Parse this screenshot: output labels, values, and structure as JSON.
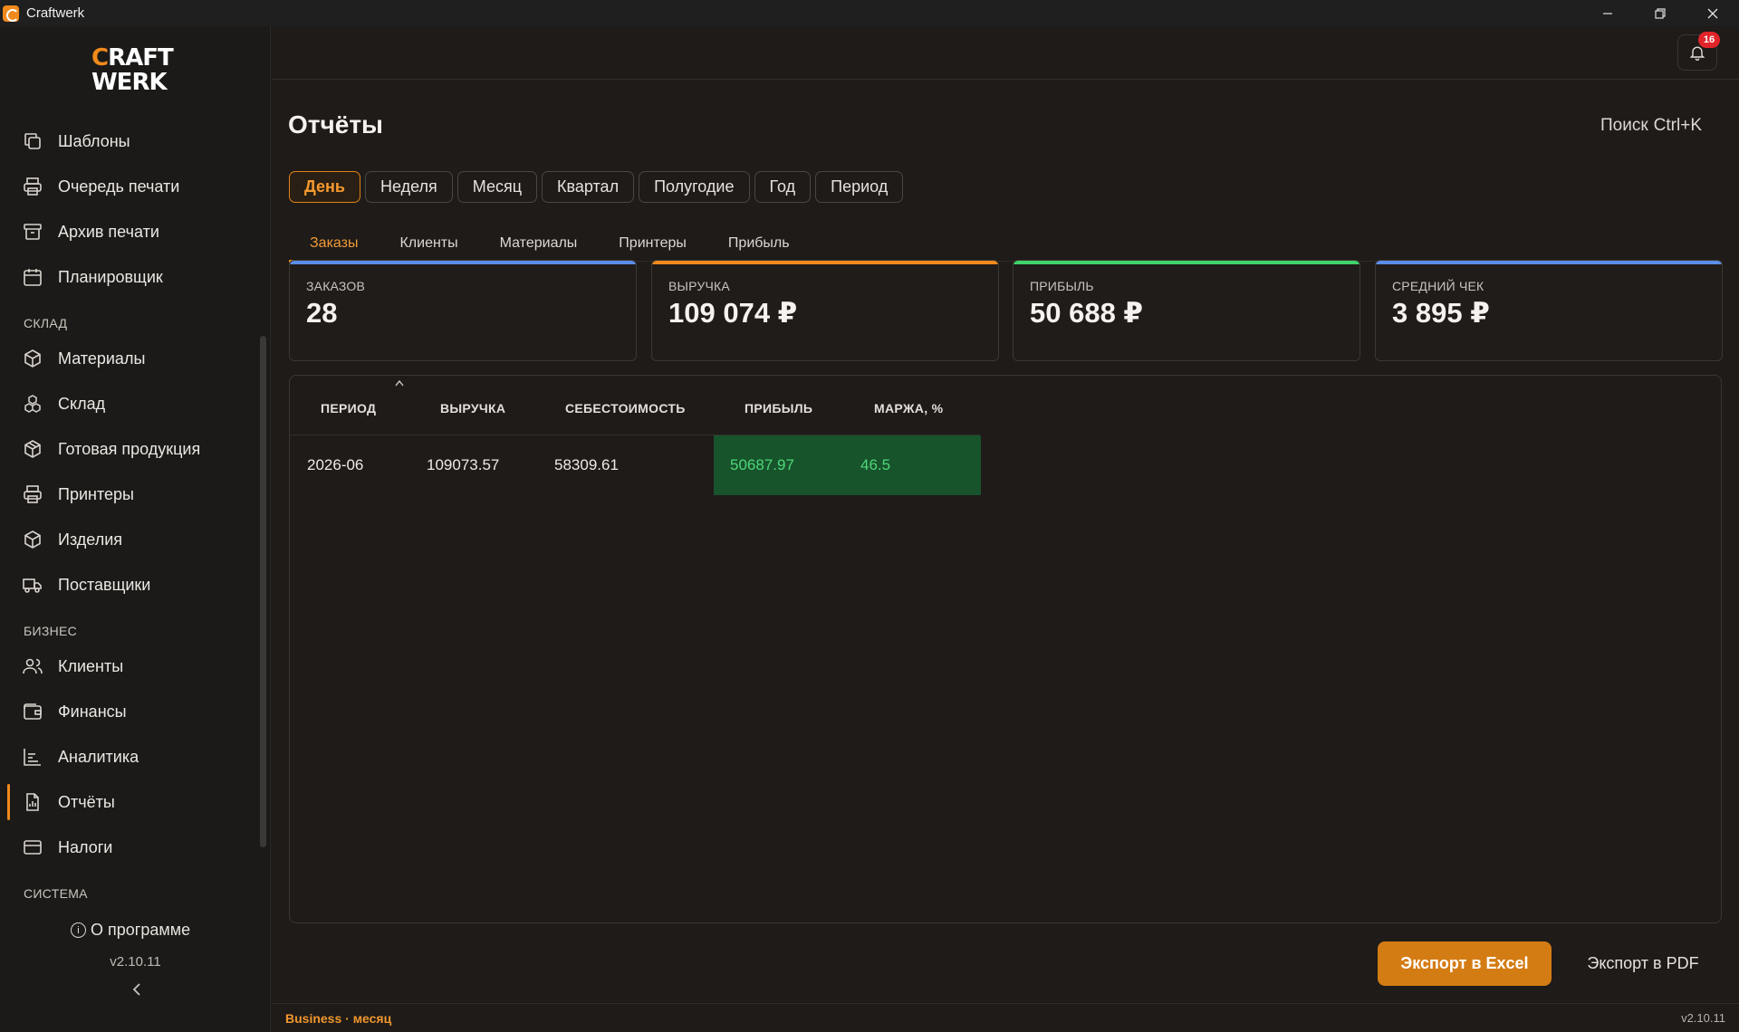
{
  "window": {
    "title": "Craftwerk"
  },
  "logo": {
    "line1": "RAFT",
    "line1_initial": "C",
    "line2": "WERK"
  },
  "sidebar": {
    "items": [
      {
        "label": "Шаблоны",
        "icon": "copy-icon"
      },
      {
        "label": "Очередь печати",
        "icon": "printer-icon"
      },
      {
        "label": "Архив печати",
        "icon": "archive-icon"
      },
      {
        "label": "Планировщик",
        "icon": "calendar-icon"
      }
    ],
    "sections": {
      "warehouse": "СКЛАД",
      "business": "БИЗНЕС",
      "system": "СИСТЕМА"
    },
    "warehouse_items": [
      {
        "label": "Материалы",
        "icon": "box-icon"
      },
      {
        "label": "Склад",
        "icon": "boxes-icon"
      },
      {
        "label": "Готовая продукция",
        "icon": "package-icon"
      },
      {
        "label": "Принтеры",
        "icon": "printer-icon"
      },
      {
        "label": "Изделия",
        "icon": "cube-icon"
      },
      {
        "label": "Поставщики",
        "icon": "truck-icon"
      }
    ],
    "business_items": [
      {
        "label": "Клиенты",
        "icon": "users-icon"
      },
      {
        "label": "Финансы",
        "icon": "wallet-icon"
      },
      {
        "label": "Аналитика",
        "icon": "bar-chart-icon"
      },
      {
        "label": "Отчёты",
        "icon": "report-icon",
        "active": true
      },
      {
        "label": "Налоги",
        "icon": "card-icon"
      }
    ],
    "about": "О программе",
    "version": "v2.10.11"
  },
  "notifications": {
    "count": "16"
  },
  "page": {
    "title": "Отчёты",
    "search_label": "Поиск",
    "search_shortcut": "Ctrl+K"
  },
  "periods": [
    "День",
    "Неделя",
    "Месяц",
    "Квартал",
    "Полугодие",
    "Год",
    "Период"
  ],
  "active_period": "День",
  "subtabs": [
    "Заказы",
    "Клиенты",
    "Материалы",
    "Принтеры",
    "Прибыль"
  ],
  "active_subtab": "Заказы",
  "kpis": [
    {
      "label": "ЗАКАЗОВ",
      "value": "28",
      "color": "#5b8ee8"
    },
    {
      "label": "ВЫРУЧКА",
      "value": "109 074 ₽",
      "color": "#f08a1c"
    },
    {
      "label": "ПРИБЫЛЬ",
      "value": "50 688 ₽",
      "color": "#3fd36b"
    },
    {
      "label": "СРЕДНИЙ ЧЕК",
      "value": "3 895 ₽",
      "color": "#5b8ee8"
    }
  ],
  "table": {
    "columns": [
      "ПЕРИОД",
      "ВЫРУЧКА",
      "СЕБЕСТОИМОСТЬ",
      "ПРИБЫЛЬ",
      "МАРЖА, %"
    ],
    "rows": [
      [
        "2026-06",
        "109073.57",
        "58309.61",
        "50687.97",
        "46.5"
      ]
    ]
  },
  "actions": {
    "export_excel": "Экспорт в Excel",
    "export_pdf": "Экспорт в PDF"
  },
  "status": {
    "left": "Business · месяц",
    "right": "v2.10.11"
  },
  "colors": {
    "accent": "#f08a1c",
    "positive": "#4fd67a",
    "badge": "#e0242a"
  }
}
